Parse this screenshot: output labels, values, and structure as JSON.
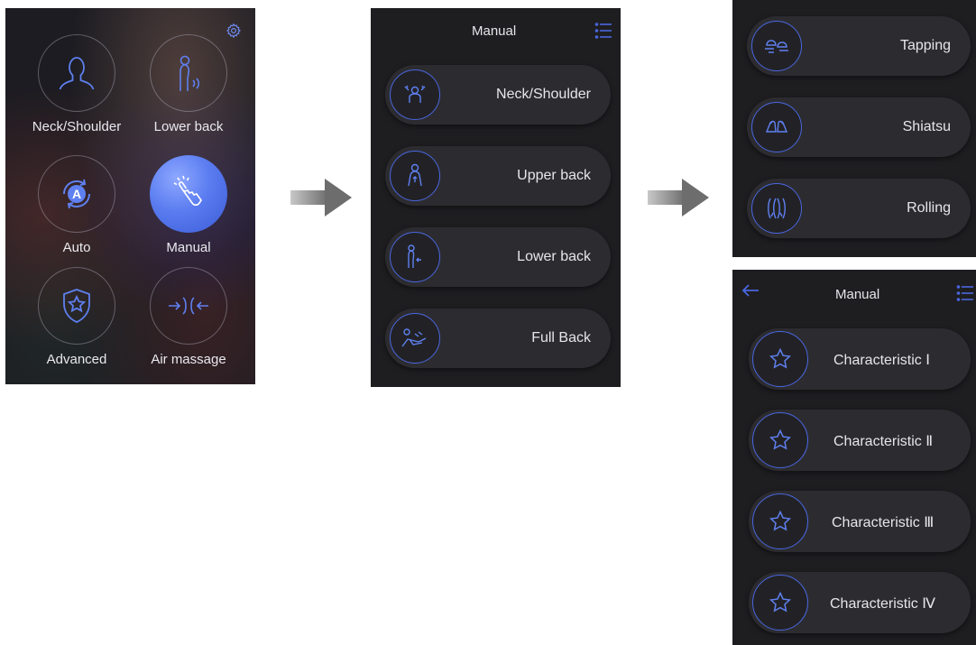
{
  "screen_home": {
    "tiles": [
      {
        "label": "Neck/Shoulder",
        "icon": "neck-shoulder-icon"
      },
      {
        "label": "Lower back",
        "icon": "lower-back-icon"
      },
      {
        "label": "Auto",
        "icon": "auto-icon"
      },
      {
        "label": "Manual",
        "icon": "manual-hand-icon",
        "active": true
      },
      {
        "label": "Advanced",
        "icon": "advanced-shield-icon"
      },
      {
        "label": "Air massage",
        "icon": "air-massage-icon"
      }
    ]
  },
  "screen_manual": {
    "title": "Manual",
    "items": [
      {
        "label": "Neck/Shoulder",
        "icon": "neck-shoulder-icon"
      },
      {
        "label": "Upper back",
        "icon": "upper-back-icon"
      },
      {
        "label": "Lower back",
        "icon": "lower-back-icon"
      },
      {
        "label": "Full Back",
        "icon": "full-back-icon"
      }
    ]
  },
  "screen_techniques": {
    "items": [
      {
        "label": "Tapping",
        "icon": "tapping-icon"
      },
      {
        "label": "Shiatsu",
        "icon": "shiatsu-icon"
      },
      {
        "label": "Rolling",
        "icon": "rolling-icon"
      }
    ]
  },
  "screen_characteristic": {
    "title": "Manual",
    "items": [
      {
        "label": "Characteristic Ⅰ",
        "icon": "star-icon"
      },
      {
        "label": "Characteristic Ⅱ",
        "icon": "star-icon"
      },
      {
        "label": "Characteristic Ⅲ",
        "icon": "star-icon"
      },
      {
        "label": "Characteristic Ⅳ",
        "icon": "star-icon"
      }
    ]
  },
  "colors": {
    "accent": "#4a66e0",
    "active_tile": "#5a7cf0",
    "panel_bg": "#1e1e21",
    "pill_bg": "#2c2c30",
    "text": "#e6e6ea"
  }
}
